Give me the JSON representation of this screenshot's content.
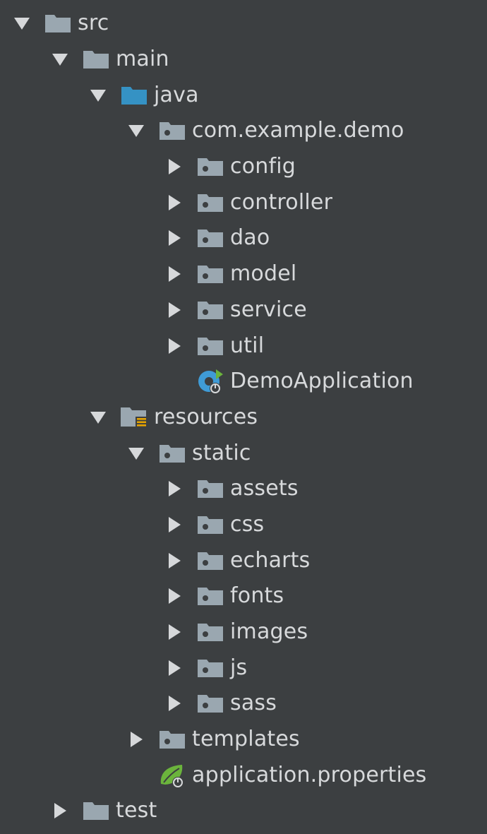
{
  "colors": {
    "background": "#3c3f41",
    "text": "#d7d9db",
    "arrow": "#d6d8da",
    "folder": "#9aa7b0",
    "source_folder": "#3592c4",
    "spring_green": "#6bb43c",
    "spring_blue": "#3f9bd6",
    "resource_bars": "#e6a400"
  },
  "tree": [
    {
      "label": "src",
      "depth": 0,
      "toggle": "expanded",
      "icon": "folder-icon"
    },
    {
      "label": "main",
      "depth": 1,
      "toggle": "expanded",
      "icon": "folder-icon"
    },
    {
      "label": "java",
      "depth": 2,
      "toggle": "expanded",
      "icon": "source-folder-icon"
    },
    {
      "label": "com.example.demo",
      "depth": 3,
      "toggle": "expanded",
      "icon": "package-icon"
    },
    {
      "label": "config",
      "depth": 4,
      "toggle": "collapsed",
      "icon": "package-icon"
    },
    {
      "label": "controller",
      "depth": 4,
      "toggle": "collapsed",
      "icon": "package-icon"
    },
    {
      "label": "dao",
      "depth": 4,
      "toggle": "collapsed",
      "icon": "package-icon"
    },
    {
      "label": "model",
      "depth": 4,
      "toggle": "collapsed",
      "icon": "package-icon"
    },
    {
      "label": "service",
      "depth": 4,
      "toggle": "collapsed",
      "icon": "package-icon"
    },
    {
      "label": "util",
      "depth": 4,
      "toggle": "collapsed",
      "icon": "package-icon"
    },
    {
      "label": "DemoApplication",
      "depth": 4,
      "toggle": "none",
      "icon": "spring-boot-class-icon"
    },
    {
      "label": "resources",
      "depth": 2,
      "toggle": "expanded",
      "icon": "resource-folder-icon"
    },
    {
      "label": "static",
      "depth": 3,
      "toggle": "expanded",
      "icon": "package-icon"
    },
    {
      "label": "assets",
      "depth": 4,
      "toggle": "collapsed",
      "icon": "package-icon"
    },
    {
      "label": "css",
      "depth": 4,
      "toggle": "collapsed",
      "icon": "package-icon"
    },
    {
      "label": "echarts",
      "depth": 4,
      "toggle": "collapsed",
      "icon": "package-icon"
    },
    {
      "label": "fonts",
      "depth": 4,
      "toggle": "collapsed",
      "icon": "package-icon"
    },
    {
      "label": "images",
      "depth": 4,
      "toggle": "collapsed",
      "icon": "package-icon"
    },
    {
      "label": "js",
      "depth": 4,
      "toggle": "collapsed",
      "icon": "package-icon"
    },
    {
      "label": "sass",
      "depth": 4,
      "toggle": "collapsed",
      "icon": "package-icon"
    },
    {
      "label": "templates",
      "depth": 3,
      "toggle": "collapsed",
      "icon": "package-icon"
    },
    {
      "label": "application.properties",
      "depth": 3,
      "toggle": "none",
      "icon": "spring-properties-icon"
    },
    {
      "label": "test",
      "depth": 1,
      "toggle": "collapsed",
      "icon": "folder-icon"
    }
  ]
}
